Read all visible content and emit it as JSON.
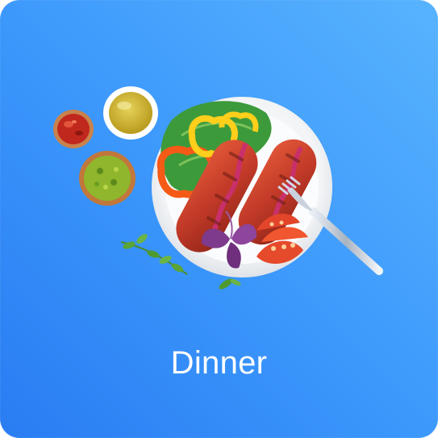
{
  "card": {
    "title": "Dinner",
    "accent_colors": {
      "gradient_start": "#2a7cf2",
      "gradient_end": "#58b3fe",
      "title_text": "#ffffff"
    }
  },
  "illustration": {
    "items": [
      "sauce-bowl-icon",
      "chili-flakes-bowl-icon",
      "herb-sauce-bowl-icon",
      "plate-icon",
      "lettuce-icon",
      "bell-pepper-rings-icon",
      "grilled-sausage-icon",
      "tomato-slices-icon",
      "basil-leaves-icon",
      "fork-icon",
      "herb-sprig-icon"
    ]
  }
}
